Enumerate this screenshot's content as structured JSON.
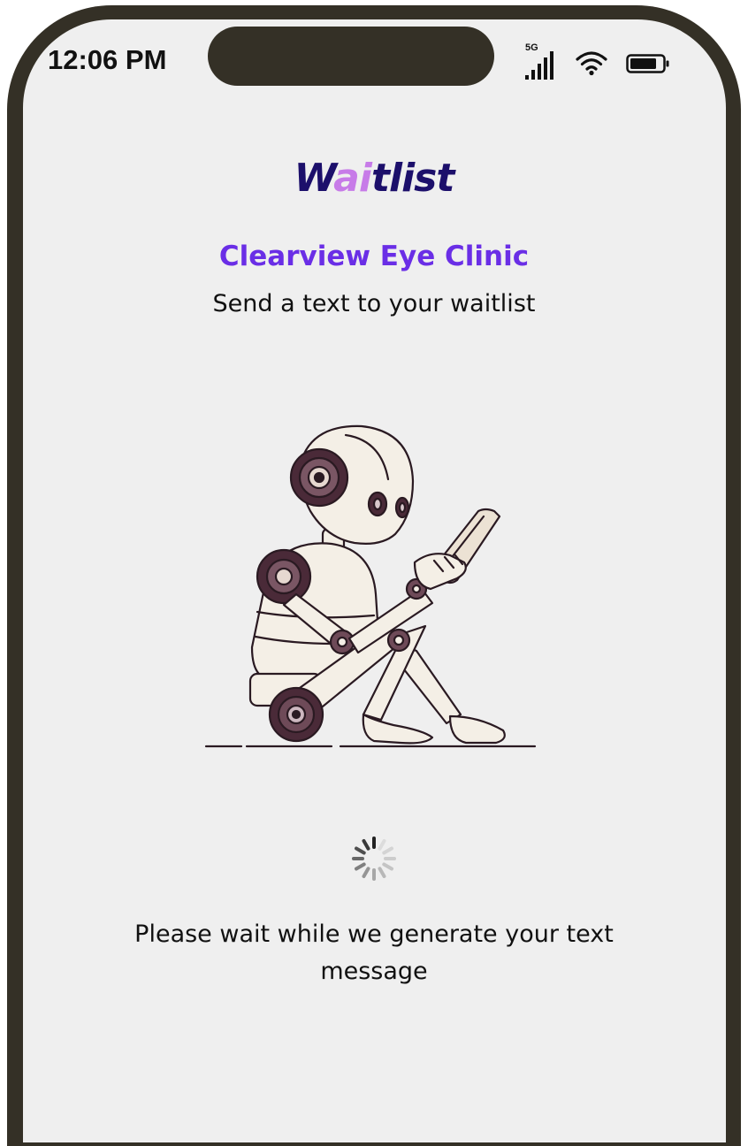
{
  "status_bar": {
    "time": "12:06 PM",
    "network": "5G",
    "icons": [
      "cellular-signal-icon",
      "wifi-icon",
      "battery-icon"
    ]
  },
  "brand": {
    "logo_prefix": "W",
    "logo_accent": "ai",
    "logo_suffix": "tlist",
    "primary_color": "#1c0f6b",
    "accent_color": "#c77be8"
  },
  "header": {
    "clinic_name": "Clearview Eye Clinic",
    "clinic_color": "#6a2ee6",
    "subtitle": "Send a text to your waitlist"
  },
  "illustration": {
    "icon": "robot-reading-phone-illustration"
  },
  "loading": {
    "icon": "loading-spinner-icon",
    "message": "Please wait while we generate your text message"
  }
}
